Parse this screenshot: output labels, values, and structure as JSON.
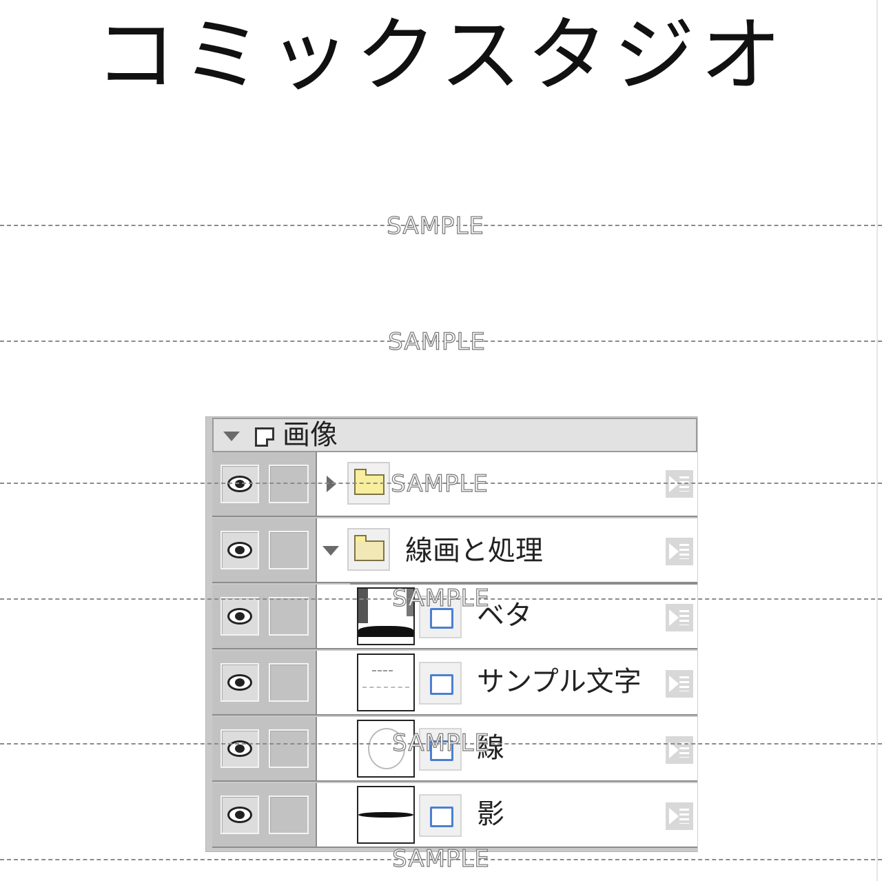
{
  "title": "コミックスタジオ",
  "watermark": "SAMPLE",
  "panel": {
    "header_label": "画像",
    "layers": [
      {
        "name": "",
        "type": "folder",
        "expanded": false,
        "visible": true
      },
      {
        "name": "線画と処理",
        "type": "folder",
        "expanded": true,
        "visible": true
      },
      {
        "name": "ベタ",
        "type": "raster",
        "visible": true
      },
      {
        "name": "サンプル文字",
        "type": "raster",
        "visible": true
      },
      {
        "name": "線",
        "type": "raster",
        "visible": true
      },
      {
        "name": "影",
        "type": "raster",
        "visible": true
      }
    ]
  },
  "colors": {
    "panel_gray": "#c2c2c2",
    "layer_icon_blue": "#4a7fd0",
    "folder_yellow": "#f7ee9e"
  },
  "icons": [
    "eye-icon",
    "lock-toggle",
    "folder-icon",
    "layer-icon",
    "layer-property-icon",
    "expand-triangle-icon",
    "collapse-triangle-icon",
    "canvas-icon"
  ]
}
